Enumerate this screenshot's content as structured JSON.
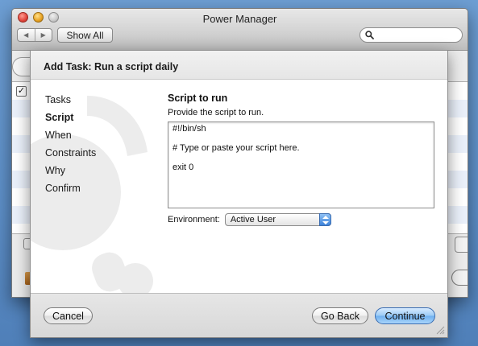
{
  "window": {
    "title": "Power Manager",
    "nav": {
      "back_glyph": "◀",
      "forward_glyph": "▶"
    },
    "show_all_label": "Show All",
    "search": {
      "placeholder": "",
      "icon": "search-icon"
    },
    "list_checkbox_glyph": "✓"
  },
  "sheet": {
    "title": "Add Task: Run a script daily",
    "steps": [
      "Tasks",
      "Script",
      "When",
      "Constraints",
      "Why",
      "Confirm"
    ],
    "active_step": "Script",
    "section_title": "Script to run",
    "section_desc": "Provide the script to run.",
    "script_lines": [
      "#!/bin/sh",
      "",
      "# Type or paste your script here.",
      "",
      "exit 0"
    ],
    "environment": {
      "label": "Environment:",
      "value": "Active User"
    },
    "buttons": {
      "cancel": "Cancel",
      "back": "Go Back",
      "continue": "Continue"
    }
  },
  "colors": {
    "desktop": "#5d8fc8",
    "default_button": "#6fb0ef",
    "stepper": "#3d83da"
  }
}
